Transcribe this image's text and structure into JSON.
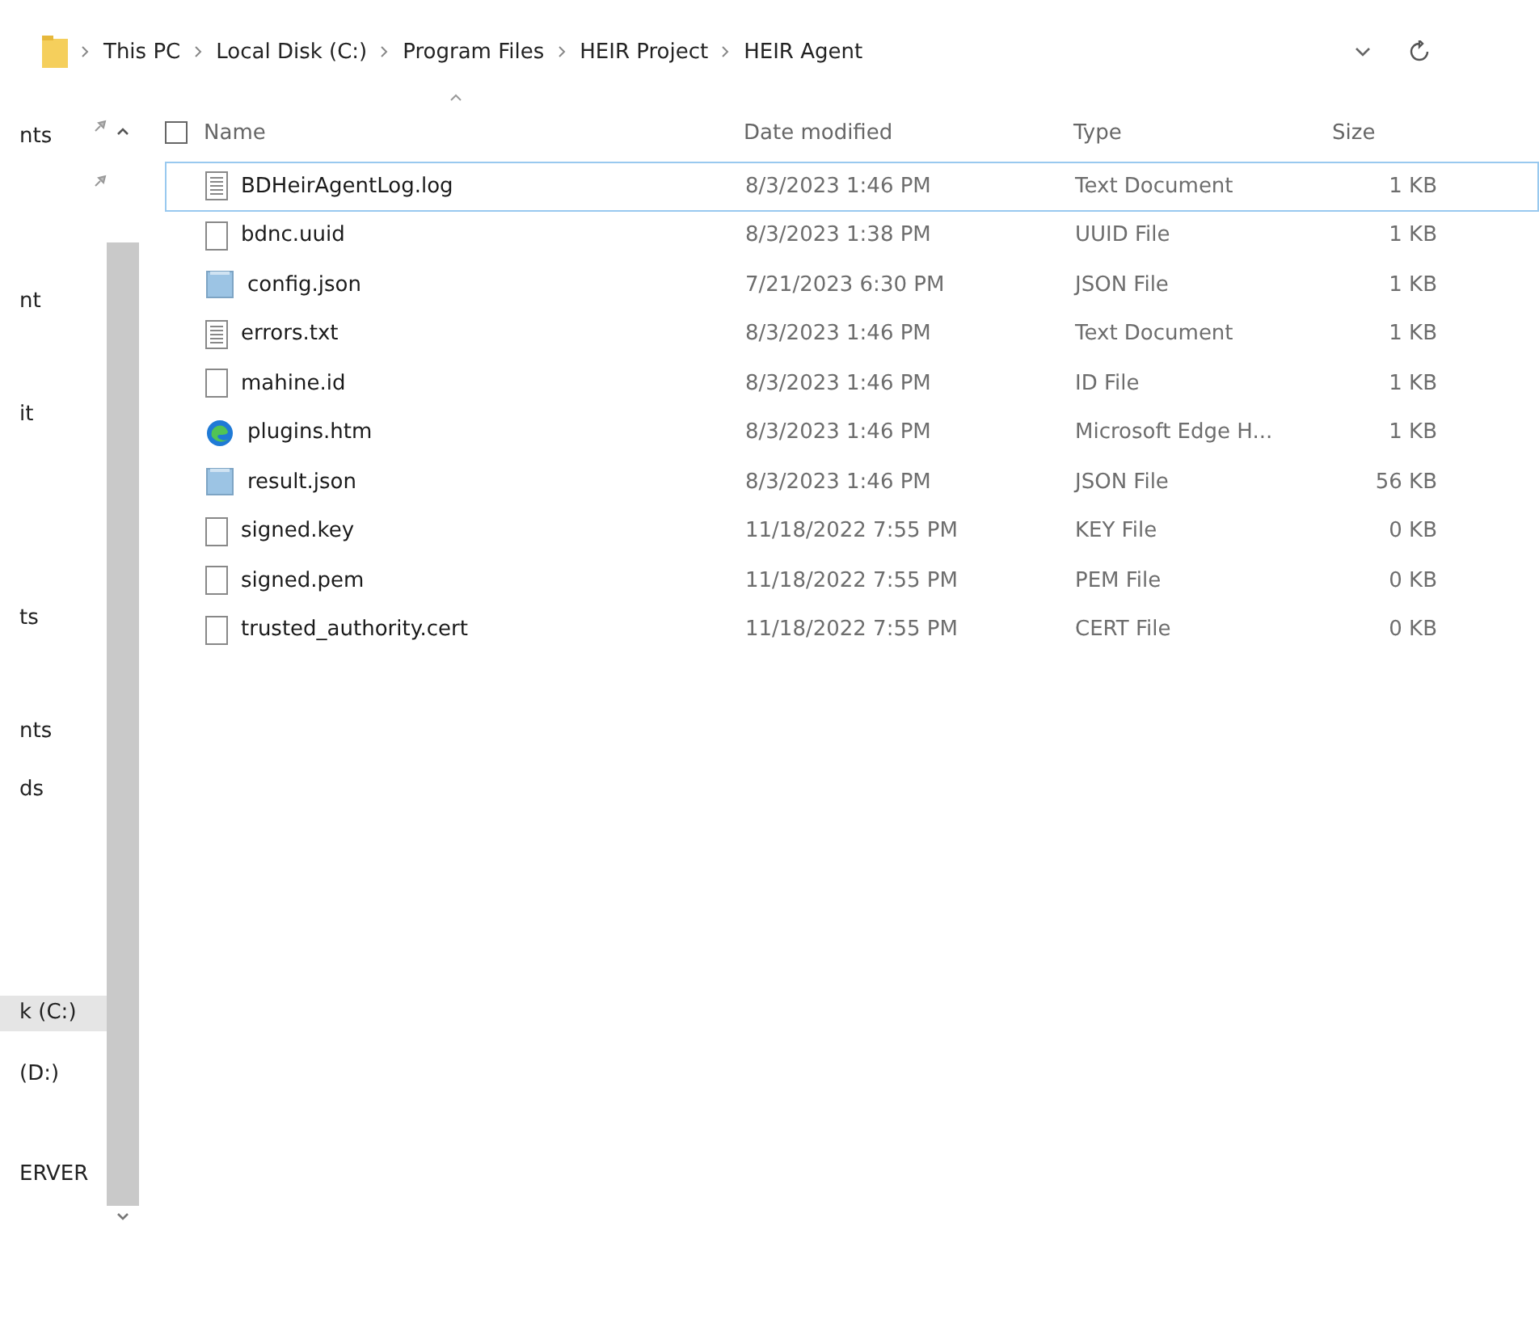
{
  "breadcrumb": [
    "This PC",
    "Local Disk (C:)",
    "Program Files",
    "HEIR Project",
    "HEIR Agent"
  ],
  "sidebar": {
    "items": [
      {
        "label": "nts",
        "selected": false
      },
      {
        "label": "nt",
        "selected": false
      },
      {
        "label": "it",
        "selected": false
      },
      {
        "label": "ts",
        "selected": false
      },
      {
        "label": "nts",
        "selected": false
      },
      {
        "label": "ds",
        "selected": false
      },
      {
        "label": "k (C:)",
        "selected": true
      },
      {
        "label": "(D:)",
        "selected": false
      },
      {
        "label": "ERVER",
        "selected": false
      }
    ]
  },
  "table": {
    "select_all": {
      "checked": false
    },
    "columns": [
      "Name",
      "Date modified",
      "Type",
      "Size"
    ],
    "rows": [
      {
        "name": "BDHeirAgentLog.log",
        "date": "8/3/2023 1:46 PM",
        "type": "Text Document",
        "size": "1 KB",
        "kind": "text",
        "selected": true
      },
      {
        "name": "bdnc.uuid",
        "date": "8/3/2023 1:38 PM",
        "type": "UUID File",
        "size": "1 KB",
        "kind": "blank",
        "selected": false
      },
      {
        "name": "config.json",
        "date": "7/21/2023 6:30 PM",
        "type": "JSON File",
        "size": "1 KB",
        "kind": "json",
        "selected": false
      },
      {
        "name": "errors.txt",
        "date": "8/3/2023 1:46 PM",
        "type": "Text Document",
        "size": "1 KB",
        "kind": "text",
        "selected": false
      },
      {
        "name": "mahine.id",
        "date": "8/3/2023 1:46 PM",
        "type": "ID File",
        "size": "1 KB",
        "kind": "blank",
        "selected": false
      },
      {
        "name": "plugins.htm",
        "date": "8/3/2023 1:46 PM",
        "type": "Microsoft Edge H...",
        "size": "1 KB",
        "kind": "edge",
        "selected": false
      },
      {
        "name": "result.json",
        "date": "8/3/2023 1:46 PM",
        "type": "JSON File",
        "size": "56 KB",
        "kind": "json",
        "selected": false
      },
      {
        "name": "signed.key",
        "date": "11/18/2022 7:55 PM",
        "type": "KEY File",
        "size": "0 KB",
        "kind": "blank",
        "selected": false
      },
      {
        "name": "signed.pem",
        "date": "11/18/2022 7:55 PM",
        "type": "PEM File",
        "size": "0 KB",
        "kind": "blank",
        "selected": false
      },
      {
        "name": "trusted_authority.cert",
        "date": "11/18/2022 7:55 PM",
        "type": "CERT File",
        "size": "0 KB",
        "kind": "blank",
        "selected": false
      }
    ]
  }
}
